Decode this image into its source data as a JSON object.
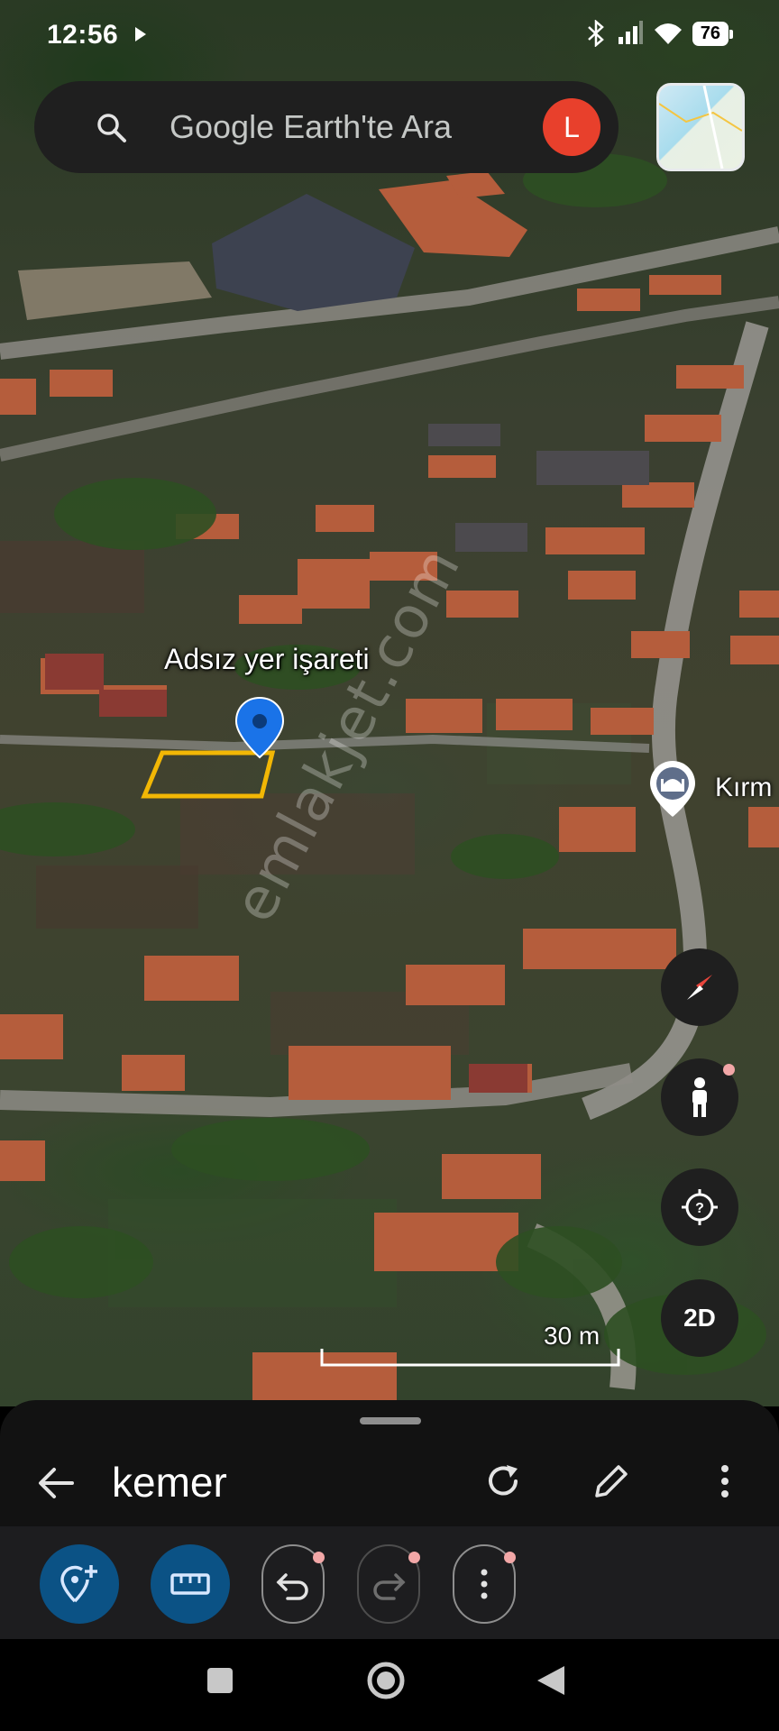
{
  "status_bar": {
    "time": "12:56",
    "battery": "76",
    "icons": [
      "play-icon",
      "bluetooth-icon",
      "signal-icon",
      "wifi-icon",
      "battery-icon"
    ]
  },
  "search": {
    "placeholder": "Google Earth'te Ara",
    "avatar_letter": "L",
    "avatar_color": "#e8402c"
  },
  "map": {
    "pin_label": "Adsız yer işareti",
    "poi_label": "Kırm",
    "watermark": "emlakjet.com",
    "scale_label": "30 m",
    "pin_color": "#1a73e8",
    "polygon_color": "#f2b705"
  },
  "map_buttons": [
    "compass-button",
    "street-view-button",
    "my-location-button",
    "2D"
  ],
  "map_button_2d_label": "2D",
  "sheet": {
    "title": "kemer",
    "actions": [
      "back-icon",
      "refresh-icon",
      "edit-icon",
      "more-icon"
    ]
  },
  "toolbar": {
    "items": [
      "add-placemark-icon",
      "measure-icon",
      "undo-icon",
      "redo-icon",
      "more-icon"
    ]
  },
  "nav": [
    "recents-icon",
    "home-icon",
    "back-icon"
  ]
}
